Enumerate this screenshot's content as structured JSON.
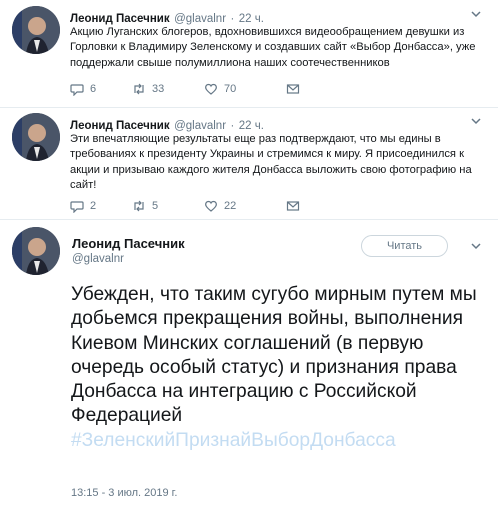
{
  "tweets": [
    {
      "name": "Леонид Пасечник",
      "handle": "@glavalnr",
      "sep": "·",
      "time": "22 ч.",
      "text": "Акцию Луганских блогеров, вдохновившихся видеообращением девушки из Горловки к Владимиру Зеленскому и создавших сайт «Выбор Донбасса», уже поддержали свыше полумиллиона наших соотечественников",
      "replies": "6",
      "retweets": "33",
      "likes": "70"
    },
    {
      "name": "Леонид Пасечник",
      "handle": "@glavalnr",
      "sep": "·",
      "time": "22 ч.",
      "text": "Эти впечатляющие результаты еще раз подтверждают, что мы едины в требованиях к президенту Украины и стремимся к миру. Я присоединился к акции и призываю каждого жителя Донбасса выложить свою фотографию на сайт!",
      "replies": "2",
      "retweets": "5",
      "likes": "22"
    }
  ],
  "main_tweet": {
    "name": "Леонид Пасечник",
    "handle": "@glavalnr",
    "read_button": "Читать",
    "text": "Убежден, что таким сугубо мирным путем мы добьемся прекращения войны, выполнения Киевом Минских соглашений (в первую очередь особый статус) и признания права Донбасса на интеграцию с Российской Федерацией",
    "hashtag": "#ЗеленскийПризнайВыборДонбасса",
    "timestamp": "13:15 - 3 июл. 2019 г."
  },
  "icons": {
    "reply": "reply-icon",
    "retweet": "retweet-icon",
    "like": "heart-icon",
    "dm": "envelope-icon",
    "menu": "chevron-down-icon"
  },
  "colors": {
    "text": "#14171a",
    "muted": "#657786",
    "hashtag_faded": "#c3dcf2",
    "border": "#e6ecf0"
  }
}
